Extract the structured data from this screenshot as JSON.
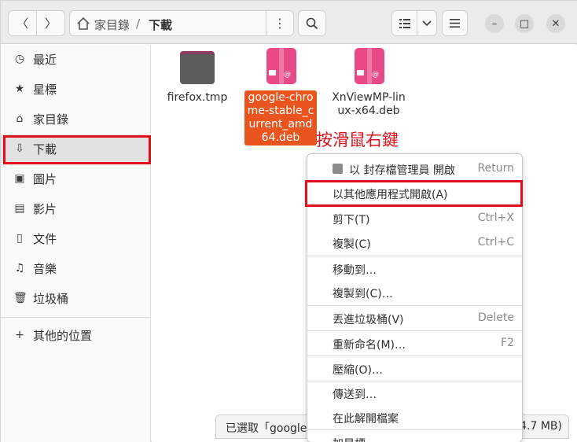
{
  "header": {
    "path": [
      "家目錄",
      "下載"
    ],
    "path_separator": "/"
  },
  "sidebar": {
    "items": [
      {
        "label": "最近",
        "icon": "clock-icon"
      },
      {
        "label": "星標",
        "icon": "star-icon"
      },
      {
        "label": "家目錄",
        "icon": "home-icon"
      },
      {
        "label": "下載",
        "icon": "download-icon",
        "active": true
      },
      {
        "label": "圖片",
        "icon": "image-icon"
      },
      {
        "label": "影片",
        "icon": "film-icon"
      },
      {
        "label": "文件",
        "icon": "document-icon"
      },
      {
        "label": "音樂",
        "icon": "music-icon"
      },
      {
        "label": "垃圾桶",
        "icon": "trash-icon"
      },
      {
        "label": "其他的位置",
        "icon": "plus-icon"
      }
    ]
  },
  "files": [
    {
      "name": "firefox.tmp",
      "type": "folder"
    },
    {
      "name": "google-chrome-stable_current_amd64.deb",
      "type": "deb",
      "selected": true
    },
    {
      "name": "XnViewMP-linux-x64.deb",
      "type": "deb"
    }
  ],
  "annotation": "按滑鼠右鍵",
  "context_menu": {
    "items": [
      {
        "label": "以 封存檔管理員 開啟",
        "accel": "Return",
        "icon": "archive-icon"
      },
      {
        "label": "以其他應用程式開啟(A)",
        "accel": ""
      },
      {
        "label": "剪下(T)",
        "accel": "Ctrl+X"
      },
      {
        "label": "複製(C)",
        "accel": "Ctrl+C"
      },
      {
        "label": "移動到…",
        "accel": ""
      },
      {
        "label": "複製到(C)…",
        "accel": ""
      },
      {
        "label": "丟進垃圾桶(V)",
        "accel": "Delete"
      },
      {
        "label": "重新命名(M)…",
        "accel": "F2"
      },
      {
        "label": "壓縮(O)…",
        "accel": ""
      },
      {
        "label": "傳送到…",
        "accel": ""
      },
      {
        "label": "在此解開檔案",
        "accel": ""
      },
      {
        "label": "加星標",
        "accel": ""
      }
    ]
  },
  "statusbar": {
    "left": "已選取「google",
    "right": "4.7 MB)"
  },
  "colors": {
    "highlight_red": "#e0101a",
    "selection_orange": "#e9541f",
    "deb_pink": "#e74a86"
  }
}
